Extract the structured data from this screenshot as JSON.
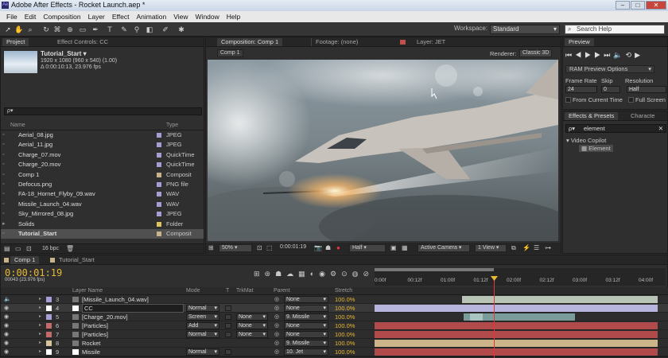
{
  "window": {
    "title": "Adobe After Effects - Rocket Launch.aep *",
    "controls": [
      "–",
      "□",
      "✕"
    ]
  },
  "menu": [
    "File",
    "Edit",
    "Composition",
    "Layer",
    "Effect",
    "Animation",
    "View",
    "Window",
    "Help"
  ],
  "toolbar": {
    "workspace_label": "Workspace:",
    "workspace_value": "Standard",
    "search_placeholder": "Search Help"
  },
  "project": {
    "tab": "Project",
    "tab2": "Effect Controls: CC",
    "item_name": "Tutorial_Start ▾",
    "item_res": "1920 x 1080  (960 x 540) (1.00)",
    "item_dur": "Δ 0:00:10:13, 23.976 fps",
    "search": "ρ▾",
    "col_name": "Name",
    "col_type": "Type",
    "bpc": "16 bpc",
    "items": [
      {
        "name": "Aerial_08.jpg",
        "type": "JPEG",
        "color": "#a59fd6"
      },
      {
        "name": "Aerial_11.jpg",
        "type": "JPEG",
        "color": "#a59fd6"
      },
      {
        "name": "Charge_07.mov",
        "type": "QuickTime",
        "color": "#a59fd6"
      },
      {
        "name": "Charge_20.mov",
        "type": "QuickTime",
        "color": "#a59fd6"
      },
      {
        "name": "Comp 1",
        "type": "Composit",
        "color": "#c9b48a"
      },
      {
        "name": "Defocus.png",
        "type": "PNG file",
        "color": "#a59fd6"
      },
      {
        "name": "FA-18_Hornet_Flyby_09.wav",
        "type": "WAV",
        "color": "#a59fd6"
      },
      {
        "name": "Missile_Launch_04.wav",
        "type": "WAV",
        "color": "#a59fd6"
      },
      {
        "name": "Sky_Mirrored_08.jpg",
        "type": "JPEG",
        "color": "#a59fd6"
      },
      {
        "name": "Solids",
        "type": "Folder",
        "color": "#e0c35c"
      },
      {
        "name": "Tutorial_Start",
        "type": "Composit",
        "color": "#c9b48a"
      }
    ]
  },
  "composition": {
    "tab": "Composition: Comp 1",
    "tab2": "Footage: (none)",
    "tab3": "Layer: JET",
    "subtab": "Comp 1",
    "renderer_label": "Renderer:",
    "renderer": "Classic 3D",
    "zoom": "50%",
    "timecode": "0:00:01:19",
    "resolution": "Half",
    "camera": "Active Camera",
    "views": "1 View"
  },
  "preview": {
    "tab": "Preview",
    "ram": "RAM Preview Options",
    "frame_rate_label": "Frame Rate",
    "skip_label": "Skip",
    "resolution_label": "Resolution",
    "frame_rate": "24",
    "skip": "0",
    "resolution": "Half",
    "from_current": "From Current Time",
    "full_screen": "Full Screen"
  },
  "effects": {
    "tab": "Effects & Presets",
    "tab2": "Characte",
    "search": "element",
    "category": "Video Copilot",
    "item": "Element"
  },
  "timeline": {
    "tab": "Comp 1",
    "tab2": "Tutorial_Start",
    "timecode": "0:00:01:19",
    "fps": "00043 (23.976 fps)",
    "col_layer": "Layer Name",
    "col_mode": "Mode",
    "col_t": "T",
    "col_trkmat": "TrkMat",
    "col_parent": "Parent",
    "col_stretch": "Stretch",
    "ruler": [
      "0:00f",
      "00:12f",
      "01:00f",
      "01:12f",
      "02:00f",
      "02:12f",
      "03:00f",
      "03:12f",
      "04:00f"
    ],
    "layers": [
      {
        "num": "3",
        "name": "[Missile_Launch_04.wav]",
        "mode": "",
        "trkmat": "",
        "parent": "None",
        "stretch": "100.0%",
        "color": "#a59fd6",
        "bar": "#b8c4b6"
      },
      {
        "num": "4",
        "name": "CC",
        "mode": "Normal",
        "trkmat": "",
        "parent": "None",
        "stretch": "100.0%",
        "color": "#ffffff",
        "bar": "#b7b4dd"
      },
      {
        "num": "5",
        "name": "[Charge_20.mov]",
        "mode": "Screen",
        "trkmat": "None",
        "parent": "9. Missile",
        "stretch": "100.0%",
        "color": "#a59fd6",
        "bar": "#7a9c9a"
      },
      {
        "num": "6",
        "name": "[Particles]",
        "mode": "Add",
        "trkmat": "None",
        "parent": "None",
        "stretch": "100.0%",
        "color": "#c46a6a",
        "bar": "#b14a4a"
      },
      {
        "num": "7",
        "name": "[Particles]",
        "mode": "Normal",
        "trkmat": "None",
        "parent": "None",
        "stretch": "100.0%",
        "color": "#c46a6a",
        "bar": "#b14a4a"
      },
      {
        "num": "8",
        "name": "Rocket",
        "mode": "",
        "trkmat": "",
        "parent": "9. Missile",
        "stretch": "100.0%",
        "color": "#d8c49a",
        "bar": "#cdb58a"
      },
      {
        "num": "9",
        "name": "Missile",
        "mode": "Normal",
        "trkmat": "",
        "parent": "10. Jet",
        "stretch": "100.0%",
        "color": "#ffffff",
        "bar": "#b14a4a"
      }
    ]
  }
}
